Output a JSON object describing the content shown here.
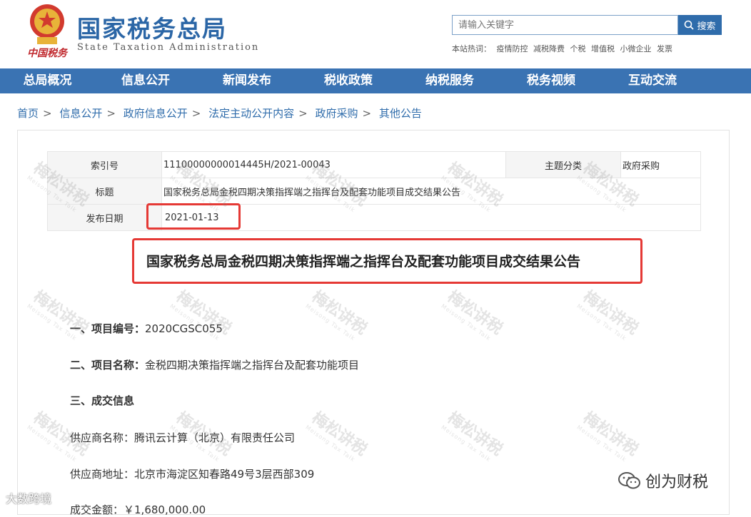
{
  "header": {
    "emblem_caption": "中国税务",
    "brand_cn": "国家税务总局",
    "brand_en": "State Taxation Administration",
    "search_placeholder": "请输入关键字",
    "search_button": "搜索",
    "hotwords_label": "本站热词：",
    "hotwords": [
      "疫情防控",
      "减税降费",
      "个税",
      "增值税",
      "小微企业",
      "发票"
    ]
  },
  "nav": {
    "items": [
      "总局概况",
      "信息公开",
      "新闻发布",
      "税收政策",
      "纳税服务",
      "税务视频",
      "互动交流"
    ]
  },
  "breadcrumb": [
    "首页",
    "信息公开",
    "政府信息公开",
    "法定主动公开内容",
    "政府采购",
    "其他公告"
  ],
  "meta": {
    "index_label": "索引号",
    "index_value": "11100000000014445H/2021-00043",
    "topic_label": "主题分类",
    "topic_value": "政府采购",
    "title_label": "标题",
    "title_value": "国家税务总局金税四期决策指挥端之指挥台及配套功能项目成交结果公告",
    "date_label": "发布日期",
    "date_value": "2021-01-13"
  },
  "document": {
    "title": "国家税务总局金税四期决策指挥端之指挥台及配套功能项目成交结果公告",
    "s1_label": "一、项目编号：",
    "s1_value": "2020CGSC055",
    "s2_label": "二、项目名称：",
    "s2_value": "金税四期决策指挥端之指挥台及配套功能项目",
    "s3_label": "三、成交信息",
    "supplier_name_label": "供应商名称：",
    "supplier_name": "腾讯云计算（北京）有限责任公司",
    "supplier_addr_label": "供应商地址：",
    "supplier_addr": "北京市海淀区知春路49号3层西部309",
    "amount_label": "成交金额：",
    "amount": "￥1,680,000.00"
  },
  "watermark": {
    "text": "梅松讲税",
    "sub": "Meisong Tax Talk"
  },
  "overlay": {
    "wechat_account": "创为财税",
    "data_logo": "大数跨境"
  },
  "colors": {
    "nav_bg": "#3a73b3",
    "brand": "#2b66a6",
    "highlight": "#e53935"
  }
}
